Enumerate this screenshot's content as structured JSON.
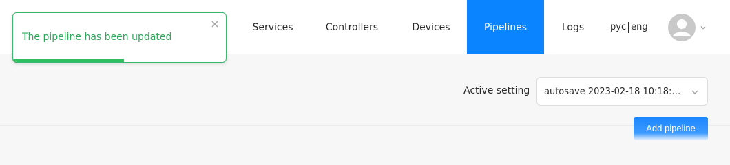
{
  "nav": {
    "items": [
      {
        "label": "Services"
      },
      {
        "label": "Controllers"
      },
      {
        "label": "Devices"
      },
      {
        "label": "Pipelines"
      },
      {
        "label": "Logs"
      }
    ],
    "active": "Pipelines",
    "lang_ru": "рус",
    "lang_en": "eng"
  },
  "toast": {
    "message": "The pipeline has been updated",
    "progress": 0.52,
    "color": "#2fa85a"
  },
  "main": {
    "active_setting_label": "Active setting",
    "active_setting_value": "autosave 2023-02-18 10:18:1...",
    "add_button_label": "Add pipeline"
  },
  "colors": {
    "accent": "#0a84ff",
    "success": "#2fbf5f"
  },
  "icons": [
    "close-icon",
    "user-avatar-icon",
    "chevron-down-icon"
  ]
}
